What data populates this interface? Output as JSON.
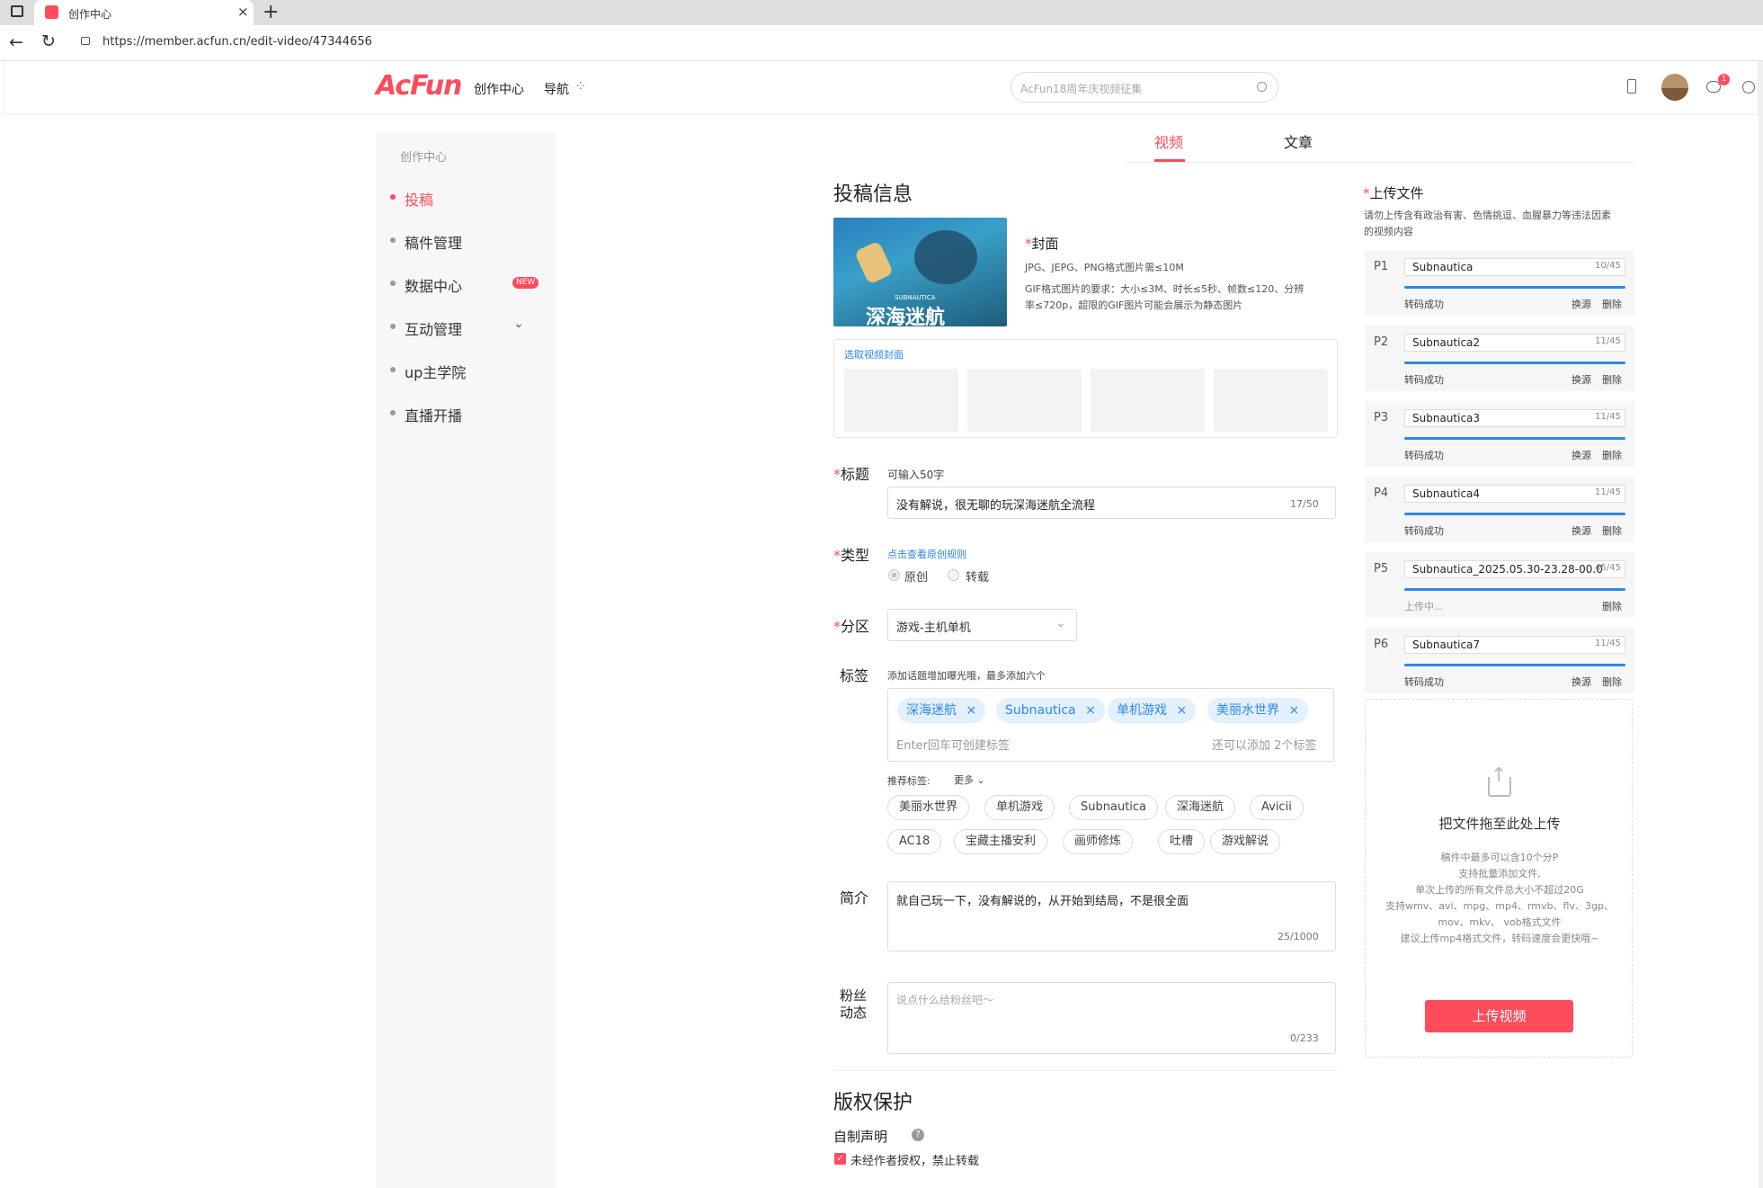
{
  "browser": {
    "tab_title": "创作中心",
    "url": "https://member.acfun.cn/edit-video/47344656"
  },
  "header": {
    "logo": "AcFun",
    "nav_creation": "创作中心",
    "nav_guide": "导航",
    "search_placeholder": "AcFun18周年庆视频征集",
    "notification_count": "1"
  },
  "sidebar": {
    "title": "创作中心",
    "items": [
      {
        "label": "投稿",
        "active": true
      },
      {
        "label": "稿件管理"
      },
      {
        "label": "数据中心",
        "badge": "NEW"
      },
      {
        "label": "互动管理"
      },
      {
        "label": "up主学院"
      },
      {
        "label": "直播开播"
      }
    ]
  },
  "tabs": [
    {
      "label": "视频",
      "active": true
    },
    {
      "label": "文章"
    }
  ],
  "form": {
    "section_title": "投稿信息",
    "cover": {
      "label": "封面",
      "format": "JPG、JEPG、PNG格式图片需≤10M",
      "gif_req": "GIF格式图片的要求：大小≤3M、时长≤5秒、帧数≤120、分辨",
      "gif_req2": "率≤720p，超限的GIF图片可能会展示为静态图片",
      "select_label": "选取视频封面",
      "image_title": "深海迷航",
      "image_sub": "SUBNAUTICA"
    },
    "title_field": {
      "label": "标题",
      "hint": "可输入50字",
      "value": "没有解说，很无聊的玩深海迷航全流程",
      "count": "17/50"
    },
    "type_field": {
      "label": "类型",
      "link": "点击查看原创规则",
      "options": [
        "原创",
        "转载"
      ]
    },
    "zone_field": {
      "label": "分区",
      "value": "游戏-主机单机"
    },
    "tags_field": {
      "label": "标签",
      "hint": "添加话题增加曝光哦，最多添加六个",
      "tags": [
        "深海迷航",
        "Subnautica",
        "单机游戏",
        "美丽水世界"
      ],
      "input_placeholder": "Enter回车可创建标签",
      "remaining": "还可以添加 2个标签",
      "recommend_label": "推荐标签:",
      "more": "更多",
      "recommended_row1": [
        "美丽水世界",
        "单机游戏",
        "Subnautica",
        "深海迷航",
        "Avicii"
      ],
      "recommended_row2": [
        "AC18",
        "宝藏主播安利",
        "画师修炼",
        "吐槽",
        "游戏解说"
      ]
    },
    "desc_field": {
      "label": "简介",
      "value": "就自己玩一下，没有解说的，从开始到结局，不是很全面",
      "count": "25/1000"
    },
    "fans_field": {
      "label1": "粉丝",
      "label2": "动态",
      "placeholder": "说点什么给粉丝吧～",
      "count": "0/233"
    },
    "copyright": {
      "title": "版权保护",
      "self_statement": "自制声明",
      "checkbox_label": "未经作者授权，禁止转载"
    }
  },
  "upload": {
    "title": "上传文件",
    "notice": "请勿上传含有政治有害、色情挑逗、血腥暴力等违法因素",
    "notice2": "的视频内容",
    "parts": [
      {
        "p": "P1",
        "name": "Subnautica",
        "count": "10/45",
        "status": "转码成功",
        "progress": 1.0
      },
      {
        "p": "P2",
        "name": "Subnautica2",
        "count": "11/45",
        "status": "转码成功",
        "progress": 1.0
      },
      {
        "p": "P3",
        "name": "Subnautica3",
        "count": "11/45",
        "status": "转码成功",
        "progress": 1.0
      },
      {
        "p": "P4",
        "name": "Subnautica4",
        "count": "11/45",
        "status": "转码成功",
        "progress": 1.0
      },
      {
        "p": "P5",
        "name": "Subnautica_2025.05.30-23.28-00.0",
        "count": "45/45",
        "status": "上传中...",
        "progress": 1.0
      },
      {
        "p": "P6",
        "name": "Subnautica7",
        "count": "11/45",
        "status": "转码成功",
        "progress": 1.0
      }
    ],
    "replace": "换源",
    "delete": "删除",
    "drop_title": "把文件拖至此处上传",
    "drop_lines": [
      "稿件中最多可以含10个分P",
      "支持批量添加文件,",
      "单次上传的所有文件总大小不超过20G",
      "支持wmv、avi、mpg、mp4、rmvb、flv、3gp、",
      "mov、mkv、 vob格式文件",
      "建议上传mp4格式文件，转码速度会更快哦~"
    ],
    "upload_button": "上传视频"
  },
  "colors": {
    "accent": "#fd4c5c",
    "link": "#2e88e8"
  }
}
